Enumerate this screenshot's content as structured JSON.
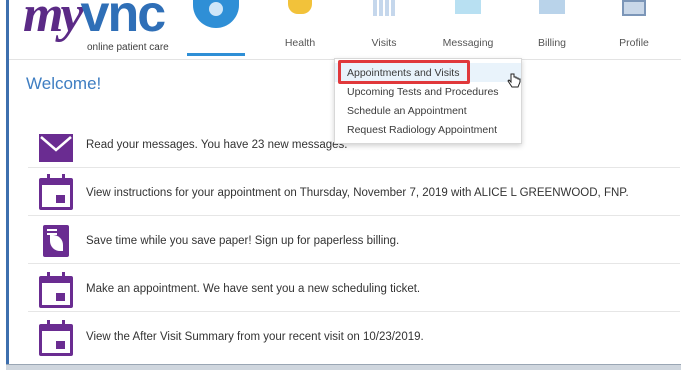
{
  "header": {
    "logo": {
      "brand_prefix": "my",
      "brand_suffix": "vnc",
      "tagline": "online patient care"
    },
    "nav": [
      {
        "label": "Health",
        "icon": "heart-icon"
      },
      {
        "label": "Visits",
        "icon": "calendar-icon"
      },
      {
        "label": "Messaging",
        "icon": "mail-icon"
      },
      {
        "label": "Billing",
        "icon": "billing-icon"
      },
      {
        "label": "Profile",
        "icon": "profile-card-icon"
      }
    ]
  },
  "dropdown": {
    "items": [
      "Appointments and Visits",
      "Upcoming Tests and Procedures",
      "Schedule an Appointment",
      "Request Radiology Appointment"
    ],
    "highlighted_index": 0
  },
  "main": {
    "welcome": "Welcome!",
    "rows": [
      {
        "icon": "envelope-icon",
        "text": "Read your messages. You have 23 new messages."
      },
      {
        "icon": "calendar-icon",
        "text": "View instructions for your appointment on Thursday, November 7, 2019 with ALICE L GREENWOOD, FNP."
      },
      {
        "icon": "paperless-leaf-icon",
        "text": "Save time while you save paper! Sign up for paperless billing."
      },
      {
        "icon": "calendar-icon",
        "text": "Make an appointment. We have sent you a new scheduling ticket."
      },
      {
        "icon": "calendar-icon",
        "text": "View the After Visit Summary from your recent visit on 10/23/2019."
      }
    ]
  },
  "colors": {
    "brand_purple": "#6a2c91",
    "brand_blue": "#2f8fd6",
    "welcome_blue": "#3f7ec2",
    "highlight_red": "#e0383b"
  }
}
